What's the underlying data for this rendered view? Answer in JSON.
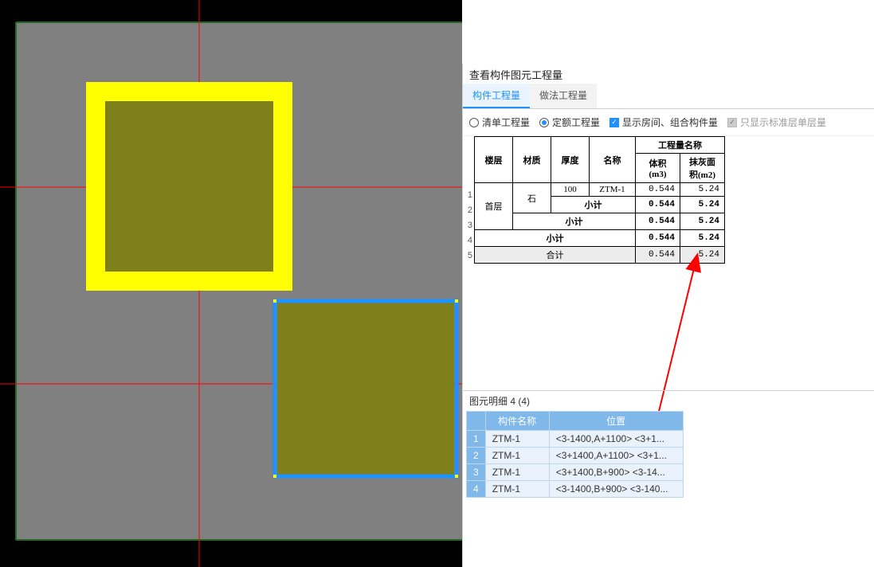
{
  "panel": {
    "title": "查看构件图元工程量",
    "tabs": {
      "t1": "构件工程量",
      "t2": "做法工程量"
    },
    "filters": {
      "radio1": "清单工程量",
      "radio2": "定额工程量",
      "check1": "显示房间、组合构件量",
      "check2": "只显示标准层单层量"
    }
  },
  "qtable": {
    "head": {
      "floor": "楼层",
      "material": "材质",
      "thickness": "厚度",
      "name": "名称",
      "qty_group": "工程量名称",
      "vol": "体积(m3)",
      "plaster": "抹灰面积(m2)"
    },
    "r1": {
      "floor": "首层",
      "material": "石",
      "thickness": "100",
      "name": "ZTM-1",
      "vol": "0.544",
      "plaster": "5.24"
    },
    "r2": {
      "name": "小计",
      "vol": "0.544",
      "plaster": "5.24"
    },
    "r3": {
      "name": "小计",
      "vol": "0.544",
      "plaster": "5.24"
    },
    "r4": {
      "name": "小计",
      "vol": "0.544",
      "plaster": "5.24"
    },
    "r5": {
      "name": "合计",
      "vol": "0.544",
      "plaster": "5.24"
    }
  },
  "rownums": {
    "n1": "1",
    "n2": "2",
    "n3": "3",
    "n4": "4",
    "n5": "5"
  },
  "detail": {
    "title": "图元明细  4 (4)",
    "head": {
      "name": "构件名称",
      "pos": "位置"
    },
    "rows": {
      "r1": {
        "n": "1",
        "name": "ZTM-1",
        "pos": "<3-1400,A+1100> <3+1..."
      },
      "r2": {
        "n": "2",
        "name": "ZTM-1",
        "pos": "<3+1400,A+1100> <3+1..."
      },
      "r3": {
        "n": "3",
        "name": "ZTM-1",
        "pos": "<3+1400,B+900> <3-14..."
      },
      "r4": {
        "n": "4",
        "name": "ZTM-1",
        "pos": "<3-1400,B+900> <3-140..."
      }
    }
  }
}
